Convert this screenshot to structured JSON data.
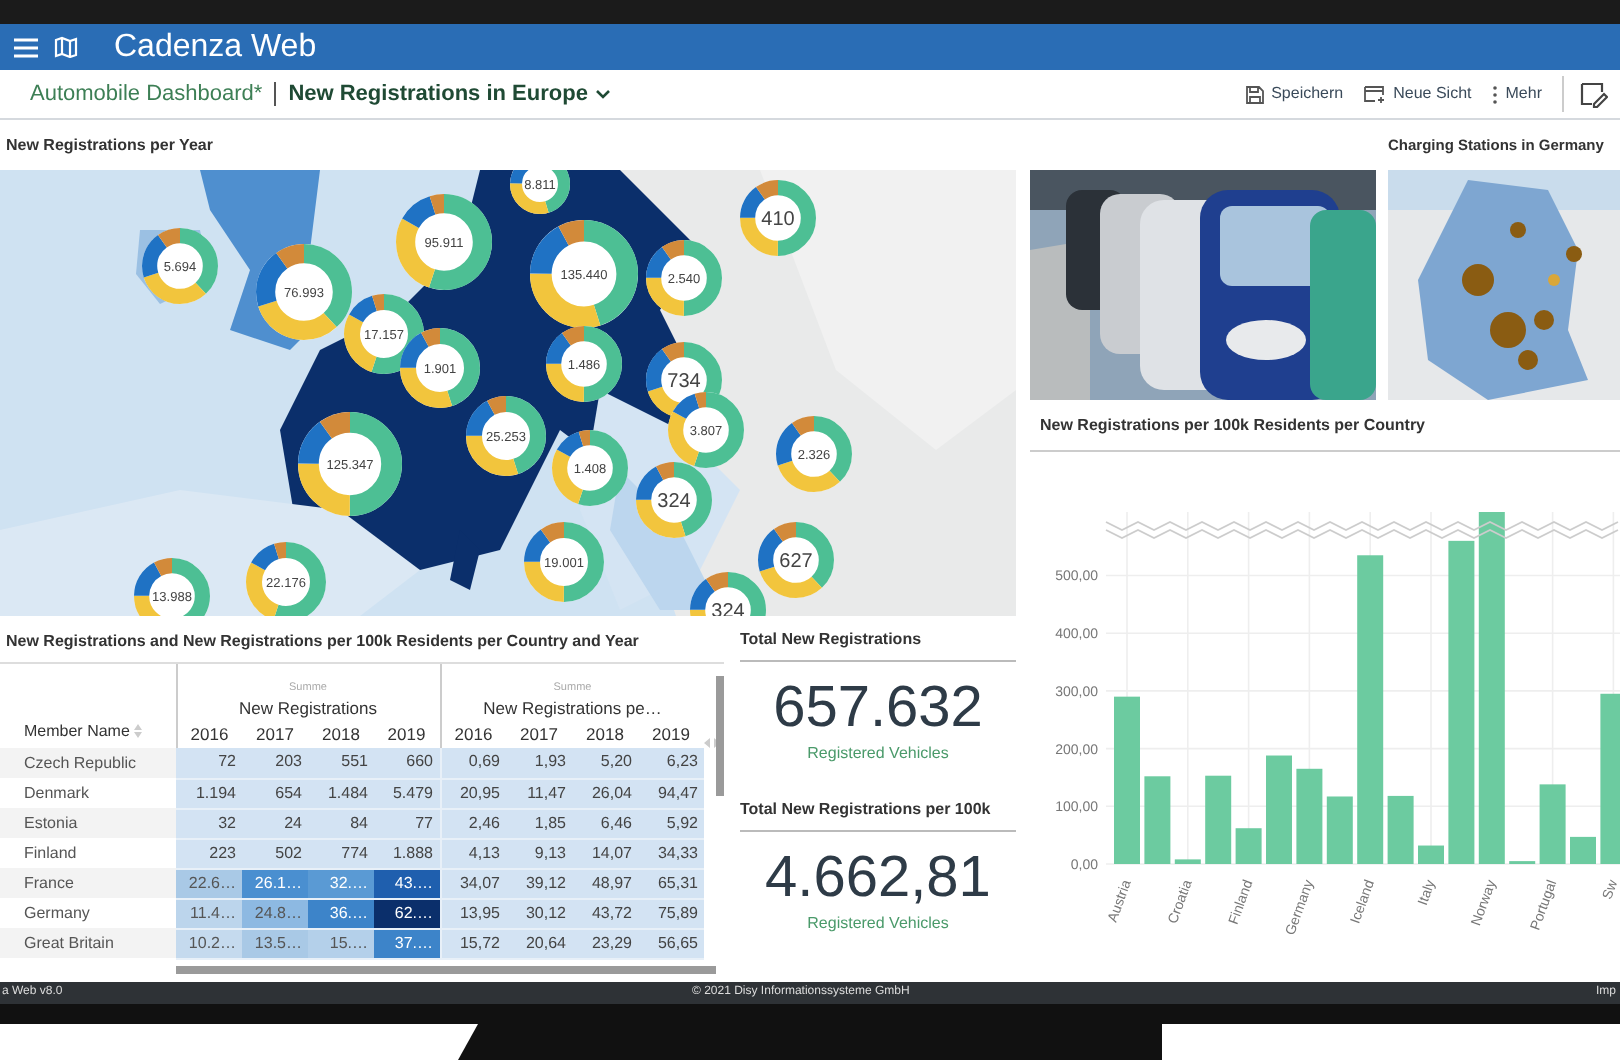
{
  "header": {
    "app_title": "Cadenza Web"
  },
  "breadcrumb": {
    "parent": "Automobile Dashboard*",
    "current": "New Registrations in Europe"
  },
  "toolbar": [
    {
      "kind": "save",
      "label": "Speichern"
    },
    {
      "kind": "new-view",
      "label": "Neue Sicht"
    },
    {
      "kind": "more",
      "label": "Mehr"
    }
  ],
  "map_panel": {
    "title": "New Registrations per Year",
    "clusters": [
      {
        "label": "8.811"
      },
      {
        "label": "410"
      },
      {
        "label": "5.694"
      },
      {
        "label": "95.911"
      },
      {
        "label": "135.440"
      },
      {
        "label": "2.540"
      },
      {
        "label": "76.993"
      },
      {
        "label": "17.157"
      },
      {
        "label": "1.901"
      },
      {
        "label": "1.486"
      },
      {
        "label": "734"
      },
      {
        "label": "3.807"
      },
      {
        "label": "25.253"
      },
      {
        "label": "125.347"
      },
      {
        "label": "2.326"
      },
      {
        "label": "1.408"
      },
      {
        "label": "324"
      },
      {
        "label": "19.001"
      },
      {
        "label": "627"
      },
      {
        "label": "22.176"
      },
      {
        "label": "13.988"
      },
      {
        "label": "324"
      }
    ]
  },
  "charging_panel": {
    "title": "Charging Stations in Germany"
  },
  "table_panel": {
    "title": "New Registrations and New Registrations per 100k Residents per Country and Year",
    "member_column": "Member Name",
    "groups": [
      {
        "aggregate": "Summe",
        "title": "New Registrations",
        "years": [
          "2016",
          "2017",
          "2018",
          "2019"
        ]
      },
      {
        "aggregate": "Summe",
        "title": "New Registrations pe…",
        "years": [
          "2016",
          "2017",
          "2018",
          "2019"
        ]
      }
    ],
    "rows": [
      {
        "name": "Czech Republic",
        "cells": [
          "72",
          "203",
          "551",
          "660",
          "0,69",
          "1,93",
          "5,20",
          "6,23"
        ]
      },
      {
        "name": "Denmark",
        "cells": [
          "1.194",
          "654",
          "1.484",
          "5.479",
          "20,95",
          "11,47",
          "26,04",
          "94,47"
        ]
      },
      {
        "name": "Estonia",
        "cells": [
          "32",
          "24",
          "84",
          "77",
          "2,46",
          "1,85",
          "6,46",
          "5,92"
        ]
      },
      {
        "name": "Finland",
        "cells": [
          "223",
          "502",
          "774",
          "1.888",
          "4,13",
          "9,13",
          "14,07",
          "34,33"
        ]
      },
      {
        "name": "France",
        "cells": [
          {
            "text": "22.6…",
            "color": "#a9c9e6"
          },
          {
            "text": "26.1…",
            "color": "#4a8fd0"
          },
          {
            "text": "32.…",
            "color": "#5a9ad4"
          },
          {
            "text": "43.…",
            "color": "#1f5fae"
          },
          "34,07",
          "39,12",
          "48,97",
          "65,31"
        ]
      },
      {
        "name": "Germany",
        "cells": [
          {
            "text": "11.4…",
            "color": "#bcd5ec"
          },
          {
            "text": "24.8…",
            "color": "#8db9e2"
          },
          {
            "text": "36.…",
            "color": "#3d84c9"
          },
          {
            "text": "62.…",
            "color": "#0b2f6b"
          },
          "13,95",
          "30,12",
          "43,72",
          "75,89"
        ]
      },
      {
        "name": "Great Britain",
        "cells": [
          {
            "text": "10.2…",
            "color": "#c5daee"
          },
          {
            "text": "13.5…",
            "color": "#a9c9e6"
          },
          {
            "text": "15.…",
            "color": "#b4d0ea"
          },
          {
            "text": "37.…",
            "color": "#3d84c9"
          },
          "15,72",
          "20,64",
          "23,29",
          "56,65"
        ]
      }
    ]
  },
  "kpis": [
    {
      "title": "Total New Registrations",
      "value": "657.632",
      "unit": "Registered Vehicles"
    },
    {
      "title": "Total New Registrations per 100k",
      "value": "4.662,81",
      "unit": "Registered Vehicles"
    }
  ],
  "chart_panel": {
    "title": "New Registrations per 100k Residents per Country",
    "axis_break": true,
    "chart_data": {
      "type": "bar",
      "categories": [
        "Austria",
        null,
        "Croatia",
        null,
        "Finland",
        null,
        "Germany",
        null,
        "Iceland",
        null,
        "Italy",
        null,
        "Norway",
        null,
        "Portugal",
        null,
        "Sw"
      ],
      "series": [
        {
          "color": "#6ccba0",
          "values": [
            290,
            152,
            8,
            153,
            62,
            188,
            165,
            117,
            535,
            118,
            32,
            560,
            610,
            5,
            138,
            47,
            295
          ]
        }
      ],
      "ylim": [
        0,
        610
      ],
      "grid": true,
      "yticks": [
        {
          "value": 0,
          "label": "0,00"
        },
        {
          "value": 100,
          "label": "100,00"
        },
        {
          "value": 200,
          "label": "200,00"
        },
        {
          "value": 300,
          "label": "300,00"
        },
        {
          "value": 400,
          "label": "400,00"
        },
        {
          "value": 500,
          "label": "500,00"
        }
      ]
    }
  },
  "footer": {
    "version": "a Web v8.0",
    "copyright": "© 2021 Disy Informationssysteme GmbH",
    "link": "Imp"
  }
}
